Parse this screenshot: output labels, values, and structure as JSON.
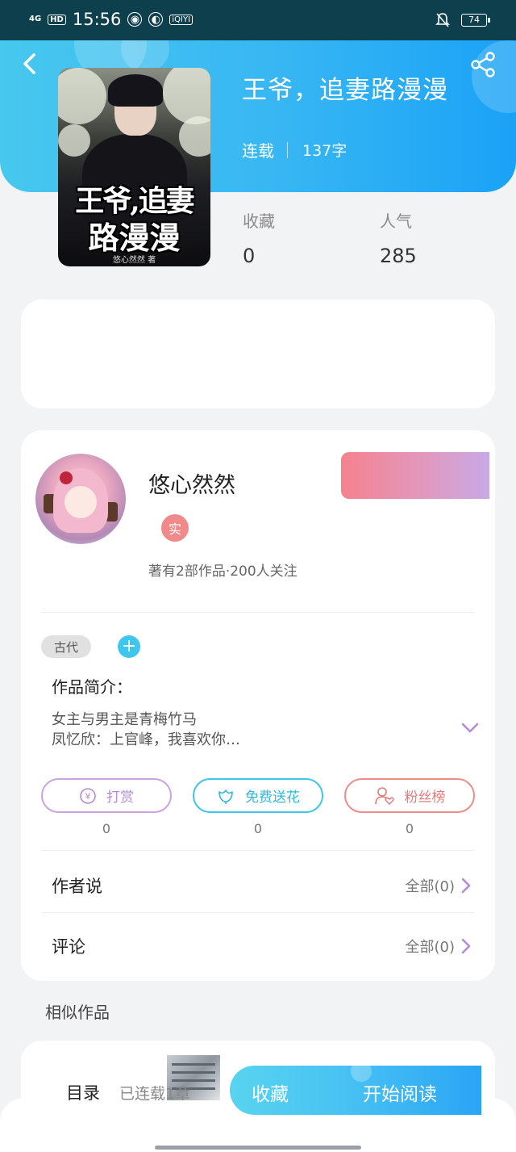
{
  "status_bar": {
    "network": "4G",
    "hd": "HD",
    "time": "15:56",
    "app_badge": "iQIYI",
    "battery": "74"
  },
  "book": {
    "title": "王爷，追妻路漫漫",
    "status": "连载",
    "words": "137字",
    "cover_title_line1": "王爷,追妻",
    "cover_title_line2": "路漫漫",
    "cover_author": "悠心然然 著",
    "stats": [
      {
        "label": "收藏",
        "value": "0"
      },
      {
        "label": "人气",
        "value": "285"
      }
    ]
  },
  "author": {
    "name": "悠心然然",
    "badge": "实",
    "info": "著有2部作品·200人关注"
  },
  "tags": {
    "genre": "古代",
    "add": "+"
  },
  "intro": {
    "label": "作品简介：",
    "line1": "女主与男主是青梅竹马",
    "line2": "凤忆欣：上官峰，我喜欢你…"
  },
  "actions": [
    {
      "label": "打赏",
      "count": "0",
      "color": "#c9a5e0",
      "icon": "coin-icon"
    },
    {
      "label": "免费送花",
      "count": "0",
      "color": "#3ec7e6",
      "icon": "flower-icon"
    },
    {
      "label": "粉丝榜",
      "count": "0",
      "color": "#ee8c8c",
      "icon": "fans-icon"
    }
  ],
  "rows": [
    {
      "title": "作者说",
      "more": "全部(0)"
    },
    {
      "title": "评论",
      "more": "全部(0)"
    }
  ],
  "similar": {
    "label": "相似作品"
  },
  "bottom": {
    "toc": "目录",
    "chapters": "已连载1章",
    "collect": "收藏",
    "read": "开始阅读"
  },
  "colors": {
    "header_start": "#47c8ee",
    "header_end": "#1aa2f6",
    "accent_purple": "#b58bd8"
  }
}
